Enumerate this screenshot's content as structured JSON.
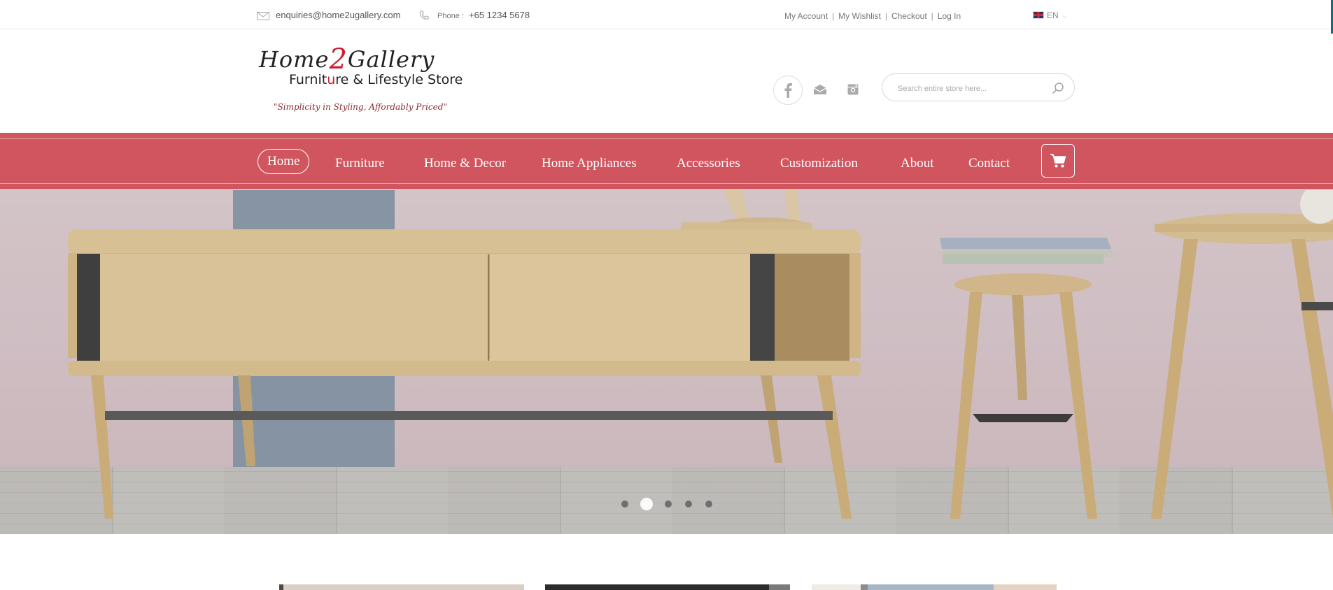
{
  "topbar": {
    "email": "enquiries@home2ugallery.com",
    "phone_label": "Phone :",
    "phone_value": "+65 1234 5678",
    "links": [
      "My Account",
      "My Wishlist",
      "Checkout",
      "Log In"
    ],
    "language": "EN"
  },
  "header": {
    "logo": {
      "line1_a": "Home",
      "line1_two": "2",
      "line1_b": "Gallery",
      "line2_a": "Furnit",
      "line2_u": "u",
      "line2_b": "re & Lifestyle Store",
      "tagline": "\"Simplicity in Styling, Affordably Priced\""
    },
    "social_icons": [
      "facebook-icon",
      "mail-icon",
      "instagram-icon"
    ],
    "search": {
      "placeholder": "Search entire store here..."
    }
  },
  "nav": {
    "items": [
      "Home",
      "Furniture",
      "Home & Decor",
      "Home Appliances",
      "Accessories",
      "Customization",
      "About",
      "Contact"
    ],
    "active_index": 0,
    "cart_icon": "cart-icon"
  },
  "slider": {
    "slide_count": 5,
    "active_slide": 2
  },
  "colors": {
    "accent": "#d1555f",
    "brand_red": "#cc1f2e"
  }
}
